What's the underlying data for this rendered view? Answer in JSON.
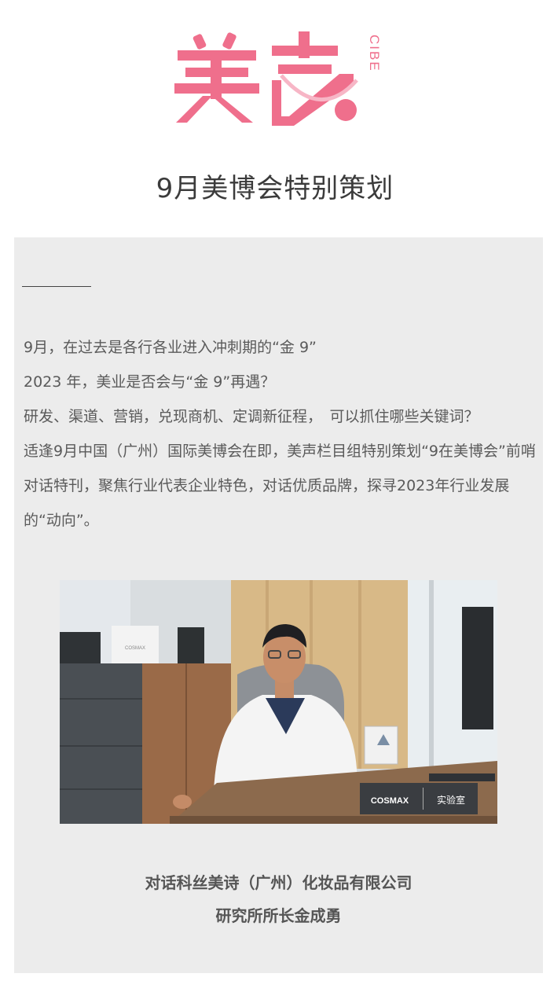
{
  "brand": {
    "logo_text": "美声",
    "logo_side_text": "CIBE",
    "accent_color": "#ef6f8c"
  },
  "header": {
    "title": "9月美博会特别策划"
  },
  "article": {
    "intro_lines": [
      "9月，在过去是各行各业进入冲刺期的“金 9”",
      "2023 年，美业是否会与“金 9”再遇？",
      "研发、渠道、营销，兑现商机、定调新征程，　可以抓住哪些关键词？",
      "适逢9月中国（广州）国际美博会在即，美声栏目组特别策划“9在美博会”前哨对话特刊，聚焦行业代表企业特色，对话优质品牌，探寻2023年行业发展的“动向”。"
    ],
    "photo": {
      "nameplate_brand": "COSMAX",
      "nameplate_label": "实验室",
      "box_brand": "COSMAX"
    },
    "caption_line1": "对话科丝美诗（广州）化妆品有限公司",
    "caption_line2": "研究所所长金成勇"
  }
}
